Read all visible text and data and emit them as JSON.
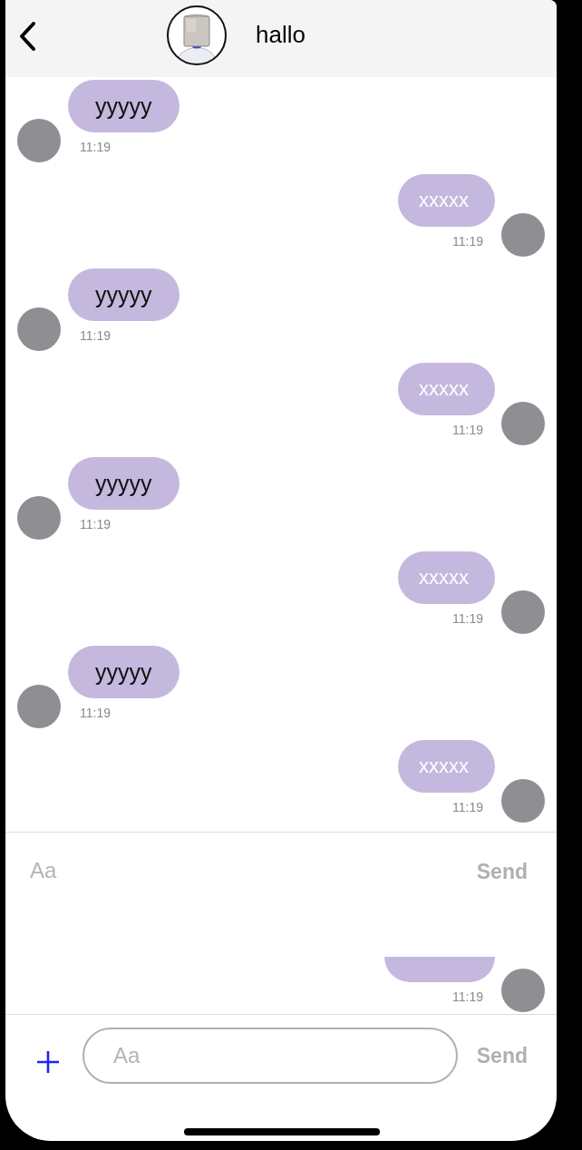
{
  "header": {
    "contact_name": "hallo"
  },
  "messages": [
    {
      "kind": "incoming",
      "text": "yyyyy",
      "time": "11:19"
    },
    {
      "kind": "outgoing",
      "text": "xxxxx",
      "time": "11:19"
    },
    {
      "kind": "incoming",
      "text": "yyyyy",
      "time": "11:19"
    },
    {
      "kind": "outgoing",
      "text": "xxxxx",
      "time": "11:19"
    },
    {
      "kind": "incoming",
      "text": "yyyyy",
      "time": "11:19"
    },
    {
      "kind": "outgoing",
      "text": "xxxxx",
      "time": "11:19"
    },
    {
      "kind": "incoming",
      "text": "yyyyy",
      "time": "11:19"
    },
    {
      "kind": "outgoing",
      "text": "xxxxx",
      "time": "11:19"
    }
  ],
  "ghost_composer": {
    "placeholder": "Aa",
    "send_label": "Send"
  },
  "partial_message": {
    "kind": "outgoing",
    "time": "11:19"
  },
  "composer": {
    "placeholder": "Aa",
    "send_label": "Send"
  }
}
